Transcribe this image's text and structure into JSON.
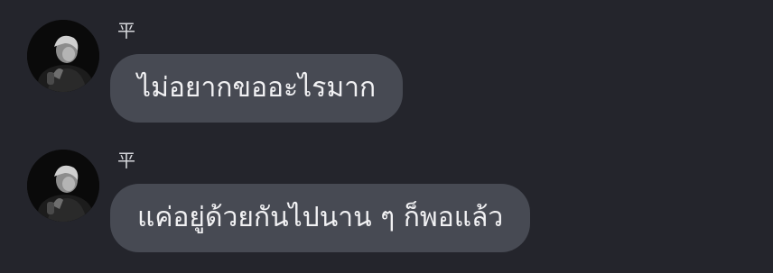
{
  "messages": [
    {
      "sender": "平",
      "text": "ไม่อยากขออะไรมาก",
      "avatar_icon": "profile-photo"
    },
    {
      "sender": "平",
      "text": "แค่อยู่ด้วยกันไปนาน ๆ ก็พอแล้ว",
      "avatar_icon": "profile-photo"
    }
  ],
  "colors": {
    "background": "#24252c",
    "bubble": "#474a53",
    "text": "#f1f1f3",
    "sender": "#d6d7db"
  }
}
